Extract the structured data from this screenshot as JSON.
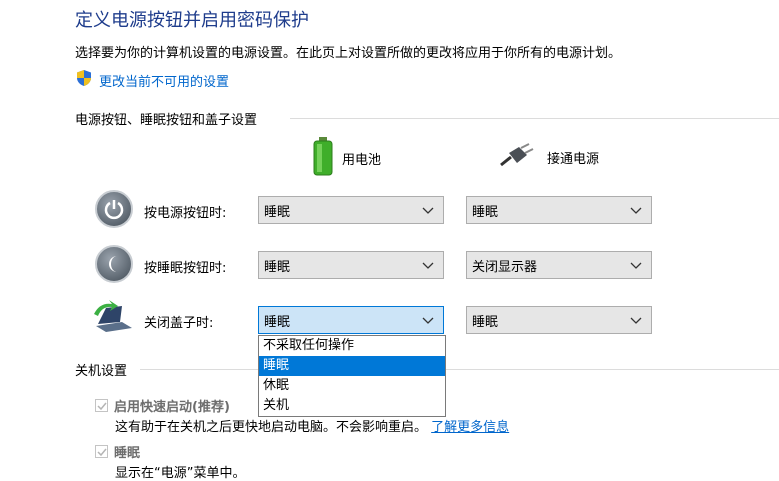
{
  "page": {
    "title": "定义电源按钮并启用密码保护",
    "description": "选择要为你的计算机设置的电源设置。在此页上对设置所做的更改将应用于你所有的电源计划。",
    "change_link": "更改当前不可用的设置"
  },
  "power_group": {
    "title": "电源按钮、睡眠按钮和盖子设置",
    "col_battery": "用电池",
    "col_plugged": "接通电源",
    "rows": [
      {
        "label": "按电源按钮时:",
        "battery": "睡眠",
        "plugged": "睡眠",
        "icon": "power-icon"
      },
      {
        "label": "按睡眠按钮时:",
        "battery": "睡眠",
        "plugged": "关闭显示器",
        "icon": "sleep-icon"
      },
      {
        "label": "关闭盖子时:",
        "battery": "睡眠",
        "plugged": "睡眠",
        "icon": "laptop-lid-icon"
      }
    ]
  },
  "dropdown": {
    "options": [
      "不采取任何操作",
      "睡眠",
      "休眠",
      "关机"
    ],
    "selected": "睡眠"
  },
  "shutdown_group": {
    "title": "关机设置",
    "fast_startup_label": "启用快速启动(推荐)",
    "fast_startup_desc": "这有助于在关机之后更快地启动电脑。不会影响重启。",
    "learn_more": "了解更多信息",
    "sleep_label": "睡眠",
    "sleep_desc": "显示在“电源”菜单中。"
  },
  "colors": {
    "title": "#1e3c8c",
    "link": "#0066cc",
    "accent": "#0078d7"
  }
}
